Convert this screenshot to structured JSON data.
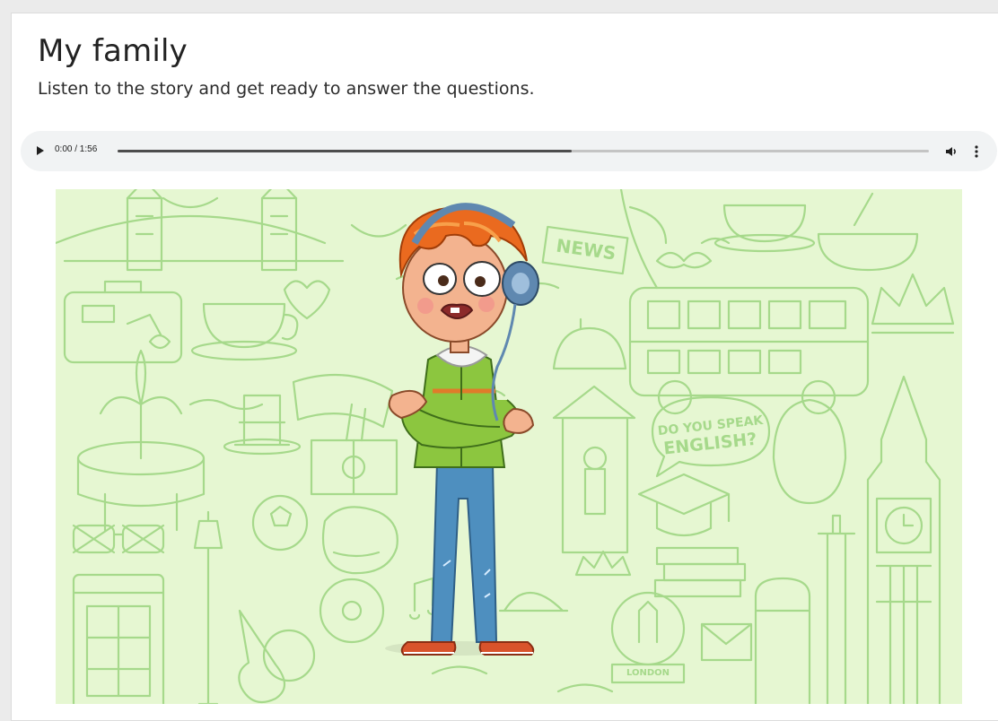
{
  "lesson": {
    "title": "My family",
    "instruction": "Listen to the story and get ready to answer the questions."
  },
  "audio": {
    "time_display": "0:00 / 1:56",
    "buffered_fraction": 0.56,
    "icons": [
      "play-icon",
      "volume-icon",
      "more-options-icon"
    ]
  },
  "illustration": {
    "speech_bubble_text": "DO YOU SPEAK ENGLISH?",
    "sign_text": "NEWS",
    "badge_text": "LONDON",
    "colors": {
      "background": "#e6f7d2",
      "doodle_lines": "#a6d98b",
      "hair": "#ea6a1f",
      "jacket": "#8cc63f",
      "jeans": "#4e8fbf",
      "headphones": "#5f88b0",
      "shoes": "#d9532b"
    }
  }
}
